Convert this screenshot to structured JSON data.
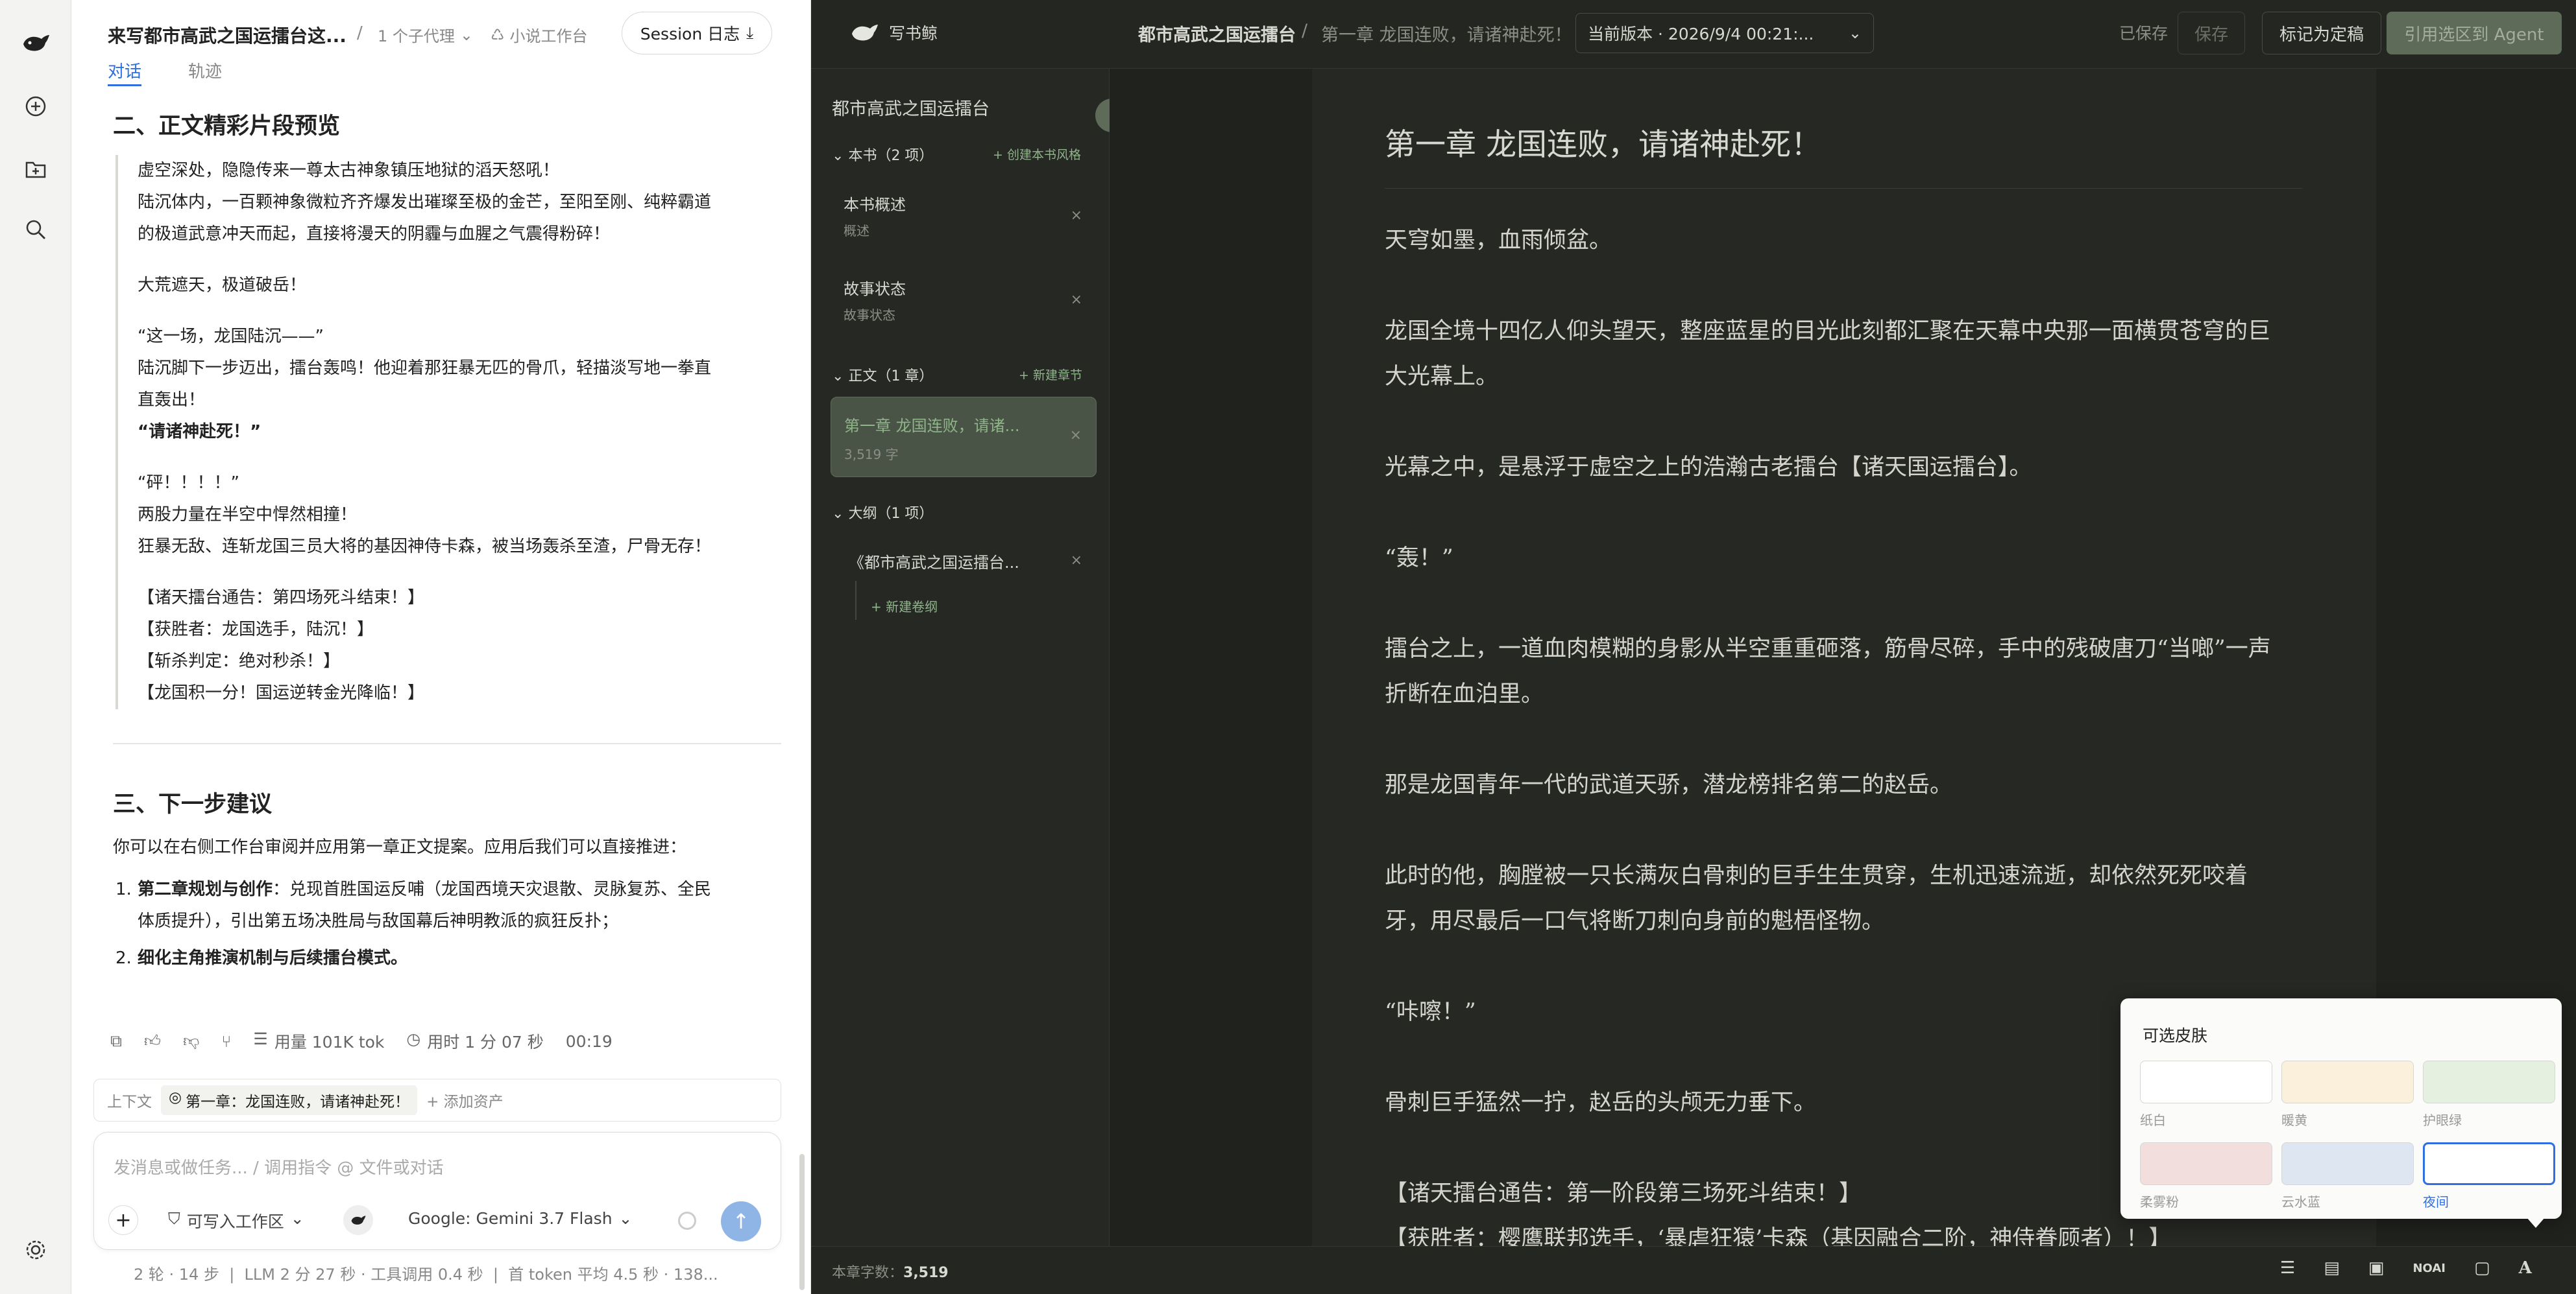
{
  "rail": {
    "icons": [
      "whale-logo-icon",
      "plus-circle-icon",
      "add-folder-icon",
      "search-icon",
      "settings-icon"
    ]
  },
  "chat": {
    "title": "来写都市高武之国运擂台这...",
    "subagent": "1 个子代理",
    "workspace": "小说工作台",
    "session_log": "Session 日志",
    "tabs": [
      "对话",
      "轨迹"
    ],
    "section2_title": "二、正文精彩片段预览",
    "excerpt": [
      "虚空深处，隐隐传来一尊太古神象镇压地狱的滔天怒吼！",
      "陆沉体内，一百颗神象微粒齐齐爆发出璀璨至极的金芒，至阳至刚、纯粹霸道",
      "的极道武意冲天而起，直接将漫天的阴霾与血腥之气震得粉碎！",
      "大荒遮天，极道破岳！",
      "“这一场，龙国陆沉——”",
      "陆沉脚下一步迈出，擂台轰鸣！他迎着那狂暴无匹的骨爪，轻描淡写地一拳直",
      "直轰出！",
      "“请诸神赴死！”",
      "“砰！！！！”",
      "两股力量在半空中悍然相撞！",
      "狂暴无敌、连斩龙国三员大将的基因神侍卡森，被当场轰杀至渣，尸骨无存！",
      "【诸天擂台通告：第四场死斗结束！】",
      "【获胜者：龙国选手，陆沉！】",
      "【斩杀判定：绝对秒杀！】",
      "【龙国积一分！国运逆转金光降临！】"
    ],
    "section3_title": "三、下一步建议",
    "intro": "你可以在右侧工作台审阅并应用第一章正文提案。应用后我们可以直接推进：",
    "list": [
      {
        "bold": "第二章规划与创作",
        "rest": "：兑现首胜国运反哺（龙国西境天灾退散、灵脉复苏、全民",
        "rest2": "体质提升），引出第五场决胜局与敌国幕后神明教派的疯狂反扑；"
      },
      {
        "bold": "细化主角推演机制与后续擂台模式。",
        "rest": "",
        "rest2": ""
      }
    ],
    "usage": "用量 101K tok",
    "duration": "用时 1 分 07 秒",
    "time": "00:19",
    "context_label": "上下文",
    "context_chip": "第一章：龙国连败，请诸神赴死！",
    "add_asset": "+ 添加资产",
    "input_placeholder": "发消息或做任务... / 调用指令 @ 文件或对话",
    "writable": "可写入工作区",
    "model": "Google: Gemini 3.7 Flash",
    "stats": "2 轮 · 14 步  |  LLM 2 分 27 秒 · 工具调用 0.4 秒  |  首 token 平均 4.5 秒 · 138..."
  },
  "editor": {
    "brand": "写书鲸",
    "book": "都市高武之国运擂台",
    "sep": "/",
    "chapter": "第一章 龙国连败，请诸神赴死！",
    "version": "当前版本 · 2026/9/4 00:21:...",
    "saved": "已保存",
    "save": "保存",
    "mark_final": "标记为定稿",
    "quote_to_agent": "引用选区到 Agent"
  },
  "outline": {
    "title": "都市高武之国运擂台",
    "book_group": "本书（2 项）",
    "create_style": "+ 创建本书风格",
    "items_book": [
      {
        "title": "本书概述",
        "sub": "概述"
      },
      {
        "title": "故事状态",
        "sub": "故事状态"
      }
    ],
    "body_group": "正文（1 章）",
    "new_chapter": "+ 新建章节",
    "chapter_item": {
      "title": "第一章 龙国连败，请诸...",
      "sub": "3,519 字"
    },
    "outline_group": "大纲（1 项）",
    "outline_item": "《都市高武之国运擂台...",
    "new_volume": "+ 新建卷纲"
  },
  "chapter": {
    "title": "第一章 龙国连败，请诸神赴死！",
    "paras": [
      "天穹如墨，血雨倾盆。",
      "龙国全境十四亿人仰头望天，整座蓝星的目光此刻都汇聚在天幕中央那一面横贯苍穹的巨",
      "大光幕上。",
      "光幕之中，是悬浮于虚空之上的浩瀚古老擂台【诸天国运擂台】。",
      "“轰！”",
      "擂台之上，一道血肉模糊的身影从半空重重砸落，筋骨尽碎，手中的残破唐刀“当啷”一声",
      "折断在血泊里。",
      "那是龙国青年一代的武道天骄，潜龙榜排名第二的赵岳。",
      "此时的他，胸膛被一只长满灰白骨刺的巨手生生贯穿，生机迅速流逝，却依然死死咬着",
      "牙，用尽最后一口气将断刀刺向身前的魁梧怪物。",
      "“咔嚓！”",
      "骨刺巨手猛然一拧，赵岳的头颅无力垂下。",
      "【诸天擂台通告：第一阶段第三场死斗结束！】",
      "【获胜者：樱鹰联邦选手，‘暴虐狂猿’卡森（基因融合二阶，神侍眷顾者）！】"
    ]
  },
  "status": {
    "word_count_label": "本章字数：",
    "word_count": "3,519",
    "noai": "NOAI"
  },
  "skins": {
    "title": "可选皮肤",
    "items": [
      {
        "label": "纸白",
        "color": "#ffffff"
      },
      {
        "label": "暖黄",
        "color": "#fbf0dc"
      },
      {
        "label": "护眼绿",
        "color": "#e5f0e0"
      },
      {
        "label": "柔雾粉",
        "color": "#f3dede"
      },
      {
        "label": "云水蓝",
        "color": "#dde6f1"
      },
      {
        "label": "夜间",
        "color": "#ffffff"
      }
    ],
    "active": "夜间"
  },
  "colors": {
    "accent_green": "#8fb48a",
    "send_blue": "#8fb4e6",
    "dark_bg": "#262824"
  }
}
